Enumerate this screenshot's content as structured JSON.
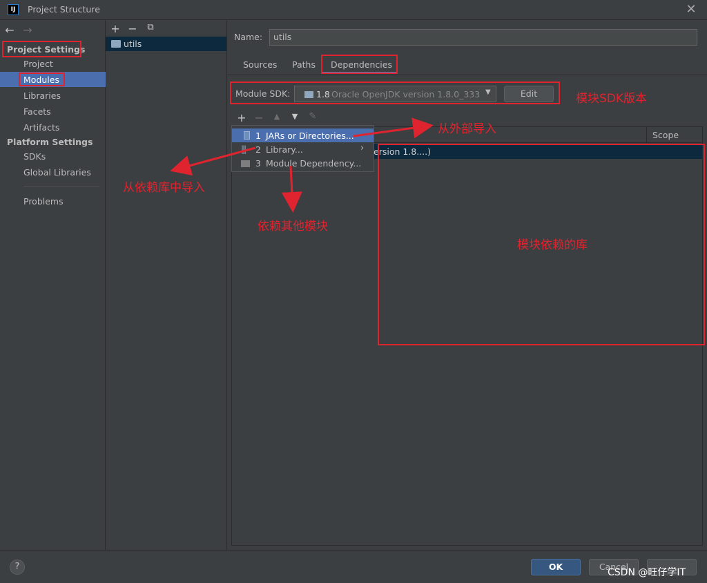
{
  "window": {
    "title": "Project Structure",
    "app_icon": "IJ"
  },
  "sidebar": {
    "project_settings": "Project Settings",
    "items1": [
      "Project",
      "Modules",
      "Libraries",
      "Facets",
      "Artifacts"
    ],
    "platform_settings": "Platform Settings",
    "items2": [
      "SDKs",
      "Global Libraries"
    ],
    "problems": "Problems"
  },
  "modules_list": {
    "items": [
      "utils"
    ]
  },
  "module": {
    "name_label": "Name:",
    "name_value": "utils",
    "tabs": [
      "Sources",
      "Paths",
      "Dependencies"
    ],
    "sdk_label": "Module SDK:",
    "sdk_version": "1.8",
    "sdk_desc": "Oracle OpenJDK version 1.8.0_333",
    "edit_label": "Edit"
  },
  "deps_table": {
    "scope_header": "Scope",
    "row_text": "ersion 1.8....)"
  },
  "add_menu": {
    "items": [
      {
        "num": "1",
        "label": "JARs or Directories..."
      },
      {
        "num": "2",
        "label": "Library..."
      },
      {
        "num": "3",
        "label": "Module Dependency..."
      }
    ]
  },
  "annotations": {
    "sdk": "模块SDK版本",
    "external": "从外部导入",
    "library": "从依赖库中导入",
    "module": "依赖其他模块",
    "deps": "模块依赖的库"
  },
  "footer": {
    "help": "?",
    "ok": "OK",
    "cancel": "Cancel",
    "watermark": "CSDN @旺仔学IT"
  },
  "colors": {
    "accent": "#4b6eaf",
    "annotation": "#e0242f",
    "ok_button": "#365880"
  }
}
